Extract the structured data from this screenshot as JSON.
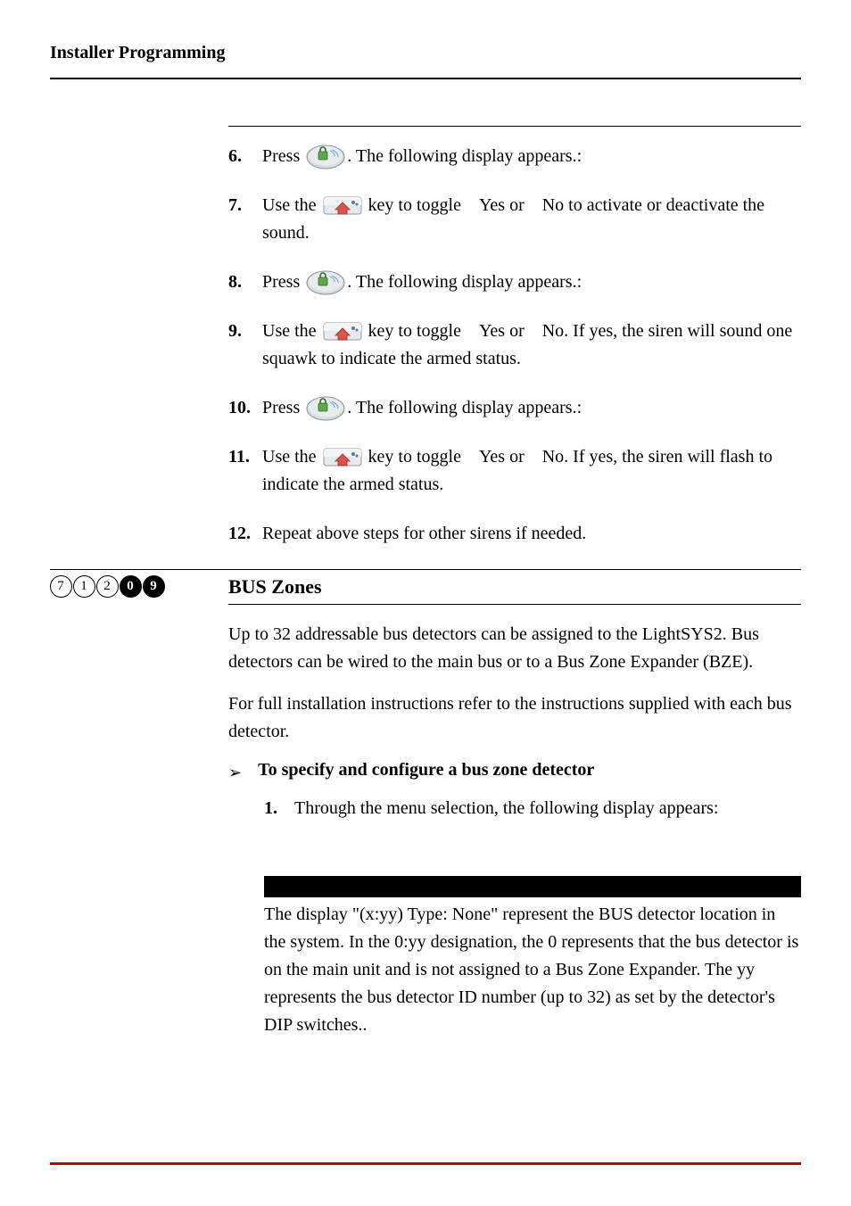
{
  "header": "Installer Programming",
  "steps": [
    {
      "n": "6.",
      "pre": "Press ",
      "icon": "disarm",
      "post": ". The following display appears.:"
    },
    {
      "n": "7.",
      "pre": "Use the ",
      "icon": "stay",
      "post": " key to toggle Yes or No to activate or deactivate the sound."
    },
    {
      "n": "8.",
      "pre": "Press ",
      "icon": "disarm",
      "post": ". The following display appears.:"
    },
    {
      "n": "9.",
      "pre": "Use the ",
      "icon": "stay",
      "post": " key to toggle Yes or No. If yes, the siren will sound one squawk to indicate the armed status."
    },
    {
      "n": "10.",
      "pre": "Press ",
      "icon": "disarm",
      "post": ". The following display appears.:"
    },
    {
      "n": "11.",
      "pre": "Use the ",
      "icon": "stay",
      "post": " key to toggle Yes or No. If yes, the siren will flash to indicate the armed status."
    },
    {
      "n": "12.",
      "pre": "Repeat above steps for other sirens if needed.",
      "icon": null,
      "post": ""
    }
  ],
  "section": {
    "code": [
      "7",
      "1",
      "2",
      "0",
      "9"
    ],
    "filled": [
      false,
      false,
      false,
      true,
      true
    ],
    "title": "BUS Zones",
    "para1": "Up to 32 addressable bus detectors can be assigned to the LightSYS2. Bus detectors can be wired to the main bus or to a Bus Zone Expander (BZE).",
    "para2": "For full installation instructions refer to the instructions supplied with each bus detector.",
    "proc_title": "To specify and configure a bus zone detector",
    "sub_step_n": "1.",
    "sub_step_text": "Through the menu selection, the following display appears:",
    "note": "The display \"(x:yy) Type: None\" represent the BUS detector location in the system. In the 0:yy designation, the 0 represents that the bus detector is on the main unit and is not assigned to a Bus Zone Expander. The yy represents the bus detector ID number (up to 32) as set by the detector's DIP switches.."
  }
}
